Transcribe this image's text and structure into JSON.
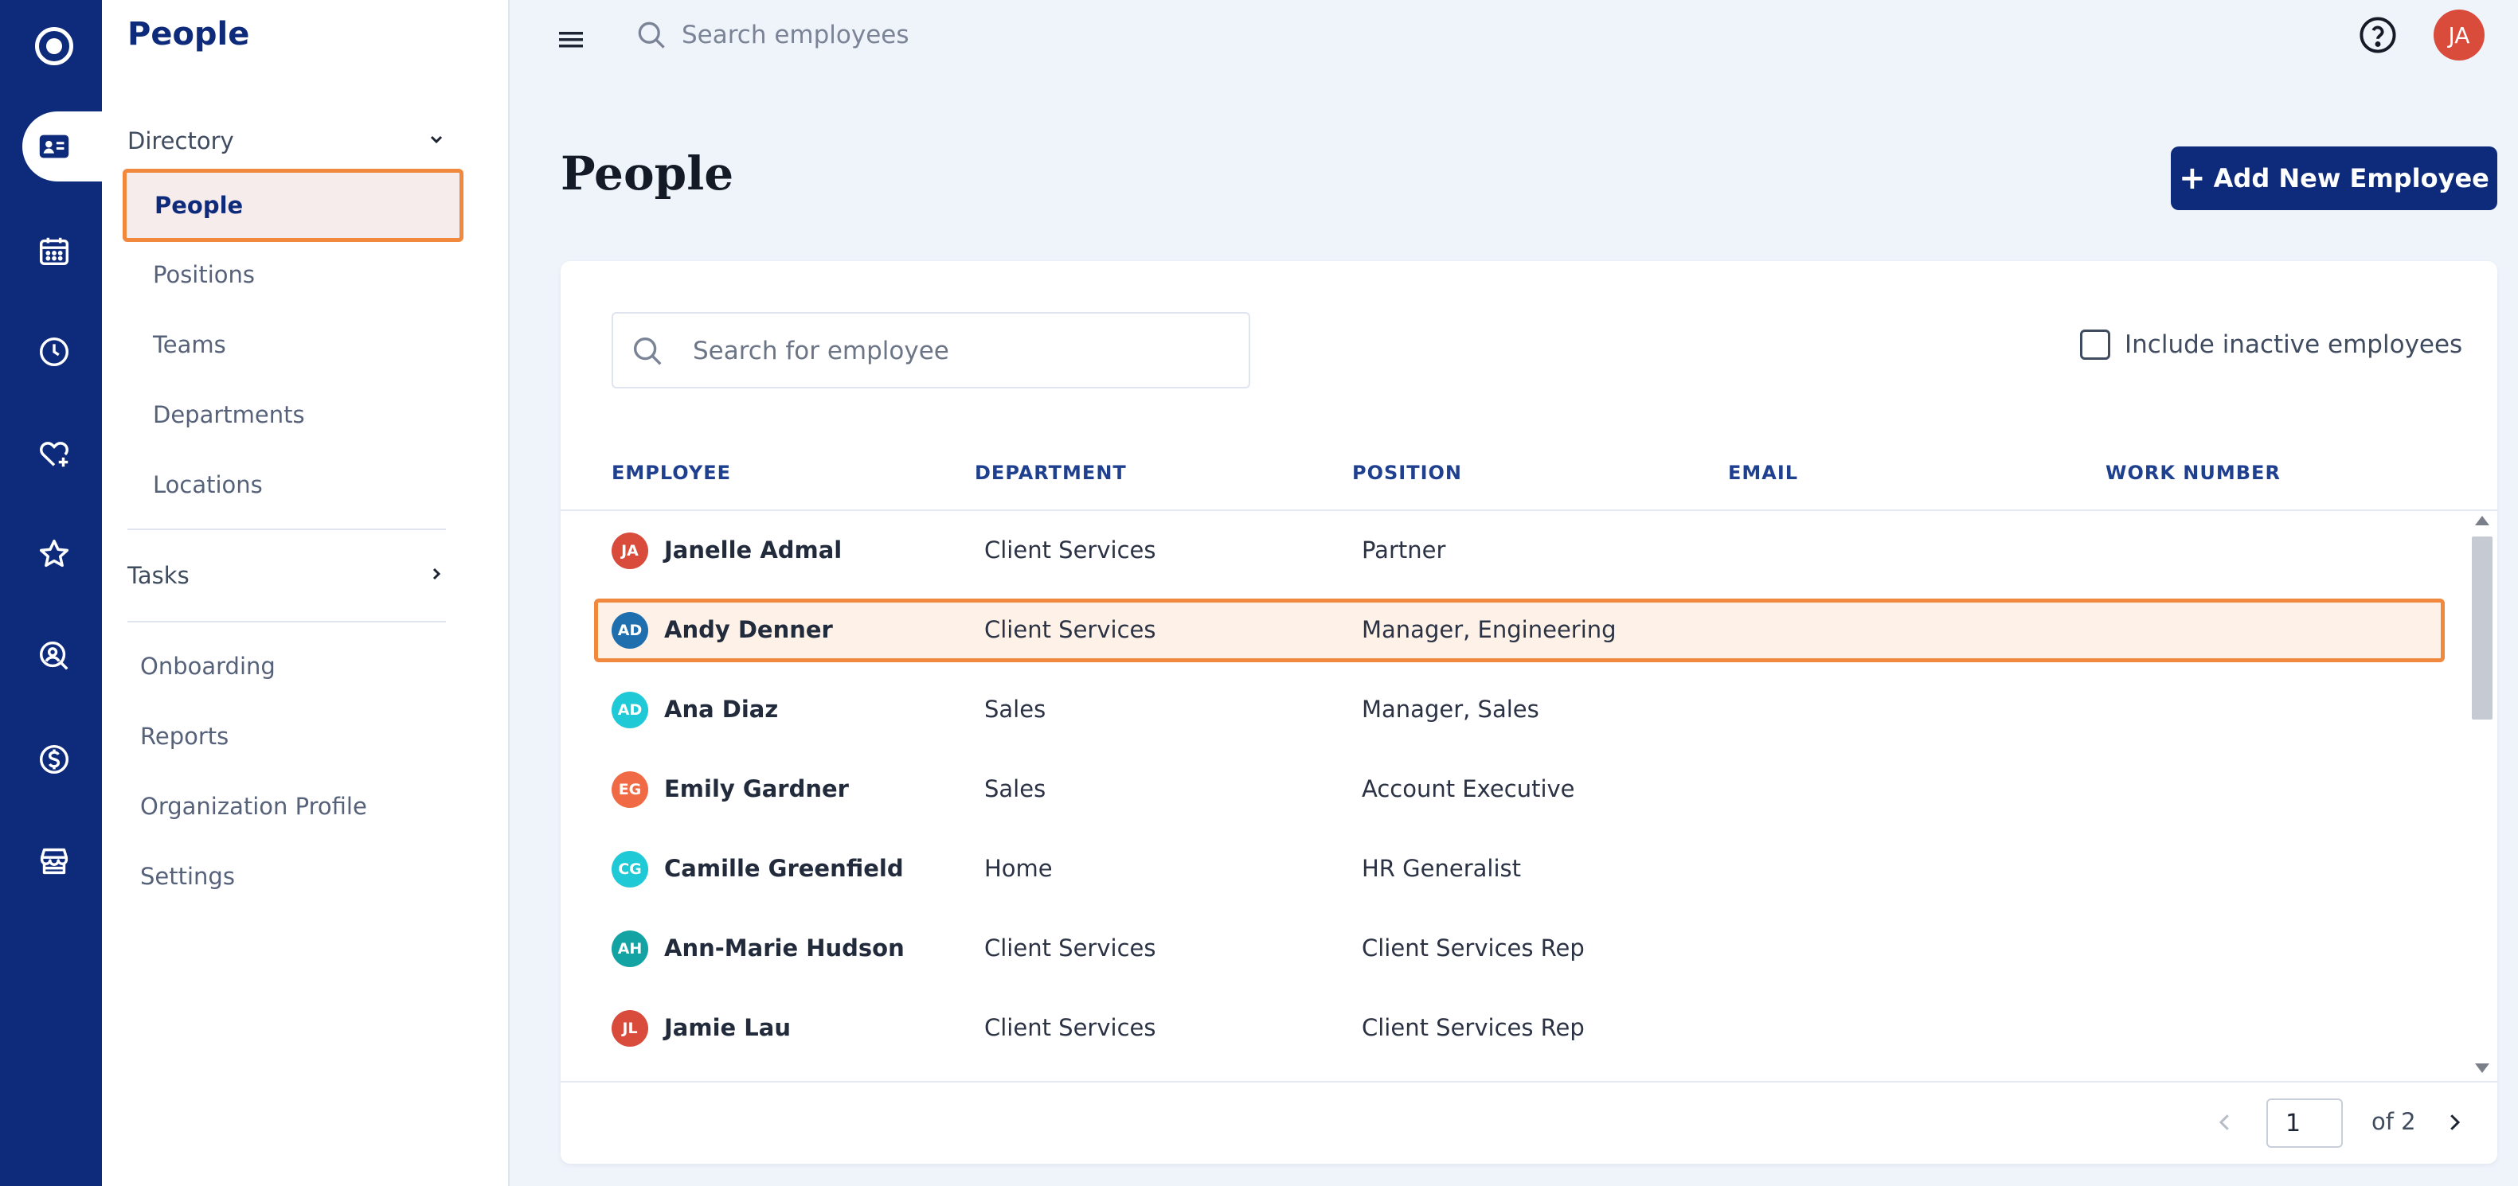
{
  "rail": {
    "colors": {
      "background": "#0e2a7a",
      "active_tab": "#ffffff"
    },
    "icons": [
      "logo-icon",
      "directory-card-icon",
      "calendar-icon",
      "clock-icon",
      "heart-plus-icon",
      "star-icon",
      "person-search-icon",
      "dollar-icon",
      "store-icon"
    ],
    "active": "directory-card-icon"
  },
  "sidebar": {
    "title": "People",
    "directory_label": "Directory",
    "directory_items": [
      {
        "label": "People",
        "active": true
      },
      {
        "label": "Positions"
      },
      {
        "label": "Teams"
      },
      {
        "label": "Departments"
      },
      {
        "label": "Locations"
      }
    ],
    "tasks_label": "Tasks",
    "links": [
      "Onboarding",
      "Reports",
      "Organization Profile",
      "Settings"
    ]
  },
  "topbar": {
    "search_placeholder": "Search employees",
    "user_initials": "JA"
  },
  "page": {
    "title": "People",
    "add_button_label": "Add New Employee"
  },
  "card": {
    "search_placeholder": "Search for employee",
    "include_inactive_label": "Include inactive employees",
    "include_inactive_checked": false,
    "columns": [
      "EMPLOYEE",
      "DEPARTMENT",
      "POSITION",
      "EMAIL",
      "WORK NUMBER"
    ],
    "rows": [
      {
        "initials": "JA",
        "avatar_color": "#d94b3b",
        "name": "Janelle Admal",
        "department": "Client Services",
        "position": "Partner",
        "email": "",
        "work_number": ""
      },
      {
        "initials": "AD",
        "avatar_color": "#1f6fae",
        "name": "Andy Denner",
        "department": "Client Services",
        "position": "Manager, Engineering",
        "email": "",
        "work_number": "",
        "selected": true
      },
      {
        "initials": "AD",
        "avatar_color": "#1fc9d6",
        "name": "Ana Diaz",
        "department": "Sales",
        "position": "Manager, Sales",
        "email": "",
        "work_number": ""
      },
      {
        "initials": "EG",
        "avatar_color": "#f06a45",
        "name": "Emily Gardner",
        "department": "Sales",
        "position": "Account Executive",
        "email": "",
        "work_number": ""
      },
      {
        "initials": "CG",
        "avatar_color": "#1fc9d6",
        "name": "Camille Greenfield",
        "department": "Home",
        "position": "HR Generalist",
        "email": "",
        "work_number": ""
      },
      {
        "initials": "AH",
        "avatar_color": "#13a3a3",
        "name": "Ann-Marie Hudson",
        "department": "Client Services",
        "position": "Client Services Rep",
        "email": "",
        "work_number": ""
      },
      {
        "initials": "JL",
        "avatar_color": "#d94b3b",
        "name": "Jamie Lau",
        "department": "Client Services",
        "position": "Client Services Rep",
        "email": "",
        "work_number": ""
      }
    ],
    "pagination": {
      "current_page": "1",
      "of_label": "of 2"
    }
  },
  "colors": {
    "brand": "#0e2a7a",
    "highlight_border": "#f0883e",
    "header_text": "#1f3f8f"
  }
}
